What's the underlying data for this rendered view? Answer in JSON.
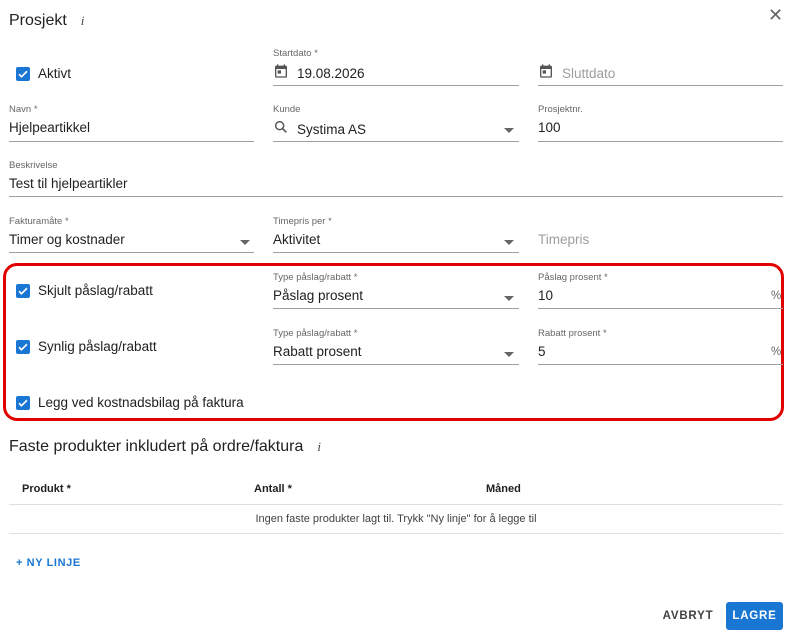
{
  "dialog": {
    "title": "Prosjekt",
    "info_glyph": "i",
    "close_glyph": "✕"
  },
  "fields": {
    "active": {
      "label": "Aktivt",
      "checked": true
    },
    "start_date": {
      "label": "Startdato *",
      "value": "19.08.2026"
    },
    "end_date": {
      "placeholder": "Sluttdato"
    },
    "name": {
      "label": "Navn *",
      "value": "Hjelpeartikkel"
    },
    "customer": {
      "label": "Kunde",
      "value": "Systima AS"
    },
    "project_number": {
      "label": "Prosjektnr.",
      "value": "100"
    },
    "description": {
      "label": "Beskrivelse",
      "value": "Test til hjelpeartikler"
    },
    "billing_method": {
      "label": "Fakturamåte *",
      "value": "Timer og kostnader"
    },
    "hourly_rate_per": {
      "label": "Timepris per *",
      "value": "Aktivitet"
    },
    "hourly_rate": {
      "placeholder": "Timepris"
    }
  },
  "markup": {
    "hidden": {
      "checkbox_label": "Skjult påslag/rabatt",
      "type_label": "Type påslag/rabatt *",
      "type_value": "Påslag prosent",
      "percent_label": "Påslag prosent *",
      "percent_value": "10",
      "suffix": "%"
    },
    "visible": {
      "checkbox_label": "Synlig påslag/rabatt",
      "type_label": "Type påslag/rabatt *",
      "type_value": "Rabatt prosent",
      "percent_label": "Rabatt prosent *",
      "percent_value": "5",
      "suffix": "%"
    },
    "attach_expense": {
      "checkbox_label": "Legg ved kostnadsbilag på faktura"
    }
  },
  "products": {
    "title": "Faste produkter inkludert på ordre/faktura",
    "columns": [
      "Produkt *",
      "Antall *",
      "Måned"
    ],
    "empty_text": "Ingen faste produkter lagt til. Trykk \"Ny linje\" for å legge til",
    "new_line_label": "+ NY LINJE"
  },
  "actions": {
    "cancel_label": "AVBRYT",
    "save_label": "LAGRE"
  },
  "colors": {
    "accent": "#1976d2",
    "highlight": "#e00000"
  }
}
